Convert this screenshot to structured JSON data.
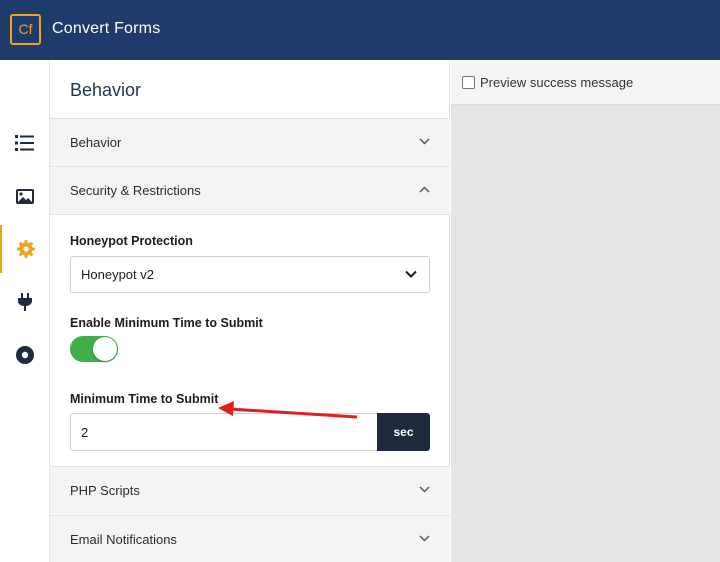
{
  "header": {
    "logo_text": "Cf",
    "app_title": "Convert Forms"
  },
  "rail": {
    "items": [
      {
        "icon": "list-icon"
      },
      {
        "icon": "image-icon"
      },
      {
        "icon": "gear-icon",
        "active": true
      },
      {
        "icon": "plug-icon"
      },
      {
        "icon": "record-icon"
      }
    ]
  },
  "panel": {
    "title": "Behavior",
    "sections": [
      {
        "label": "Behavior",
        "expanded": false
      },
      {
        "label": "Security & Restrictions",
        "expanded": true
      },
      {
        "label": "PHP Scripts",
        "expanded": false
      },
      {
        "label": "Email Notifications",
        "expanded": false
      }
    ],
    "honeypot": {
      "label": "Honeypot Protection",
      "value": "Honeypot v2"
    },
    "min_time_toggle": {
      "label": "Enable Minimum Time to Submit",
      "on": true
    },
    "min_time": {
      "label": "Minimum Time to Submit",
      "value": "2",
      "suffix": "sec"
    }
  },
  "preview": {
    "checkbox_label": "Preview success message",
    "checked": false
  },
  "colors": {
    "header": "#1f3b6b",
    "accent": "#f0a31c",
    "toggle_on": "#3fae4b",
    "annotation": "#e02020"
  }
}
